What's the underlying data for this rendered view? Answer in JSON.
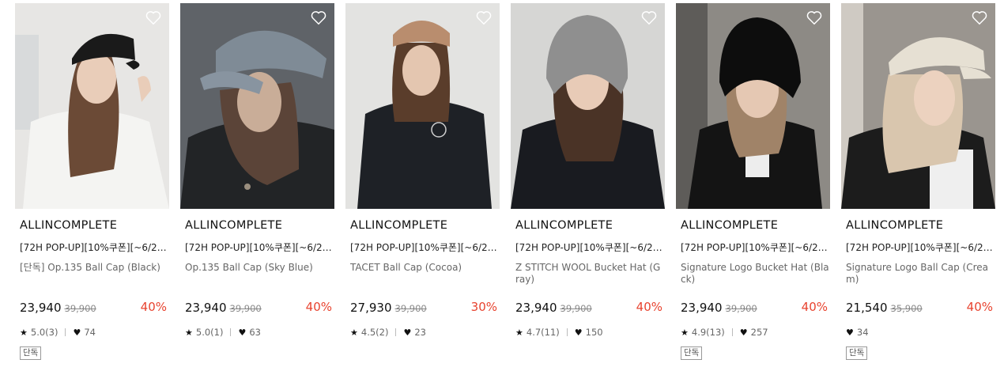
{
  "colors": {
    "discount": "#e8432f",
    "text": "#111111",
    "muted": "#666666"
  },
  "products": [
    {
      "brand": "ALLINCOMPLETE",
      "promo": "[72H POP-UP][10%쿠폰][~6/22…",
      "name": "[단독] Op.135 Ball Cap (Black)",
      "price": "23,940",
      "original_price": "39,900",
      "discount": "40%",
      "rating": "5.0(3)",
      "likes": "74",
      "badge": "단독",
      "like_icon": "heart-outline-icon"
    },
    {
      "brand": "ALLINCOMPLETE",
      "promo": "[72H POP-UP][10%쿠폰][~6/22…",
      "name": "Op.135 Ball Cap (Sky Blue)",
      "price": "23,940",
      "original_price": "39,900",
      "discount": "40%",
      "rating": "5.0(1)",
      "likes": "63",
      "like_icon": "heart-outline-icon"
    },
    {
      "brand": "ALLINCOMPLETE",
      "promo": "[72H POP-UP][10%쿠폰][~6/22…",
      "name": "TACET Ball Cap (Cocoa)",
      "price": "27,930",
      "original_price": "39,900",
      "discount": "30%",
      "rating": "4.5(2)",
      "likes": "23",
      "like_icon": "heart-outline-icon"
    },
    {
      "brand": "ALLINCOMPLETE",
      "promo": "[72H POP-UP][10%쿠폰][~6/22…",
      "name": "Z STITCH WOOL Bucket Hat (Gray)",
      "price": "23,940",
      "original_price": "39,900",
      "discount": "40%",
      "rating": "4.7(11)",
      "likes": "150",
      "like_icon": "heart-outline-icon"
    },
    {
      "brand": "ALLINCOMPLETE",
      "promo": "[72H POP-UP][10%쿠폰][~6/22…",
      "name": "Signature Logo Bucket Hat (Black)",
      "price": "23,940",
      "original_price": "39,900",
      "discount": "40%",
      "rating": "4.9(13)",
      "likes": "257",
      "badge": "단독",
      "like_icon": "heart-outline-icon"
    },
    {
      "brand": "ALLINCOMPLETE",
      "promo": "[72H POP-UP][10%쿠폰][~6/22…",
      "name": "Signature Logo Ball Cap (Cream)",
      "price": "21,540",
      "original_price": "35,900",
      "discount": "40%",
      "likes": "34",
      "badge": "단독",
      "like_icon": "heart-outline-icon"
    }
  ]
}
